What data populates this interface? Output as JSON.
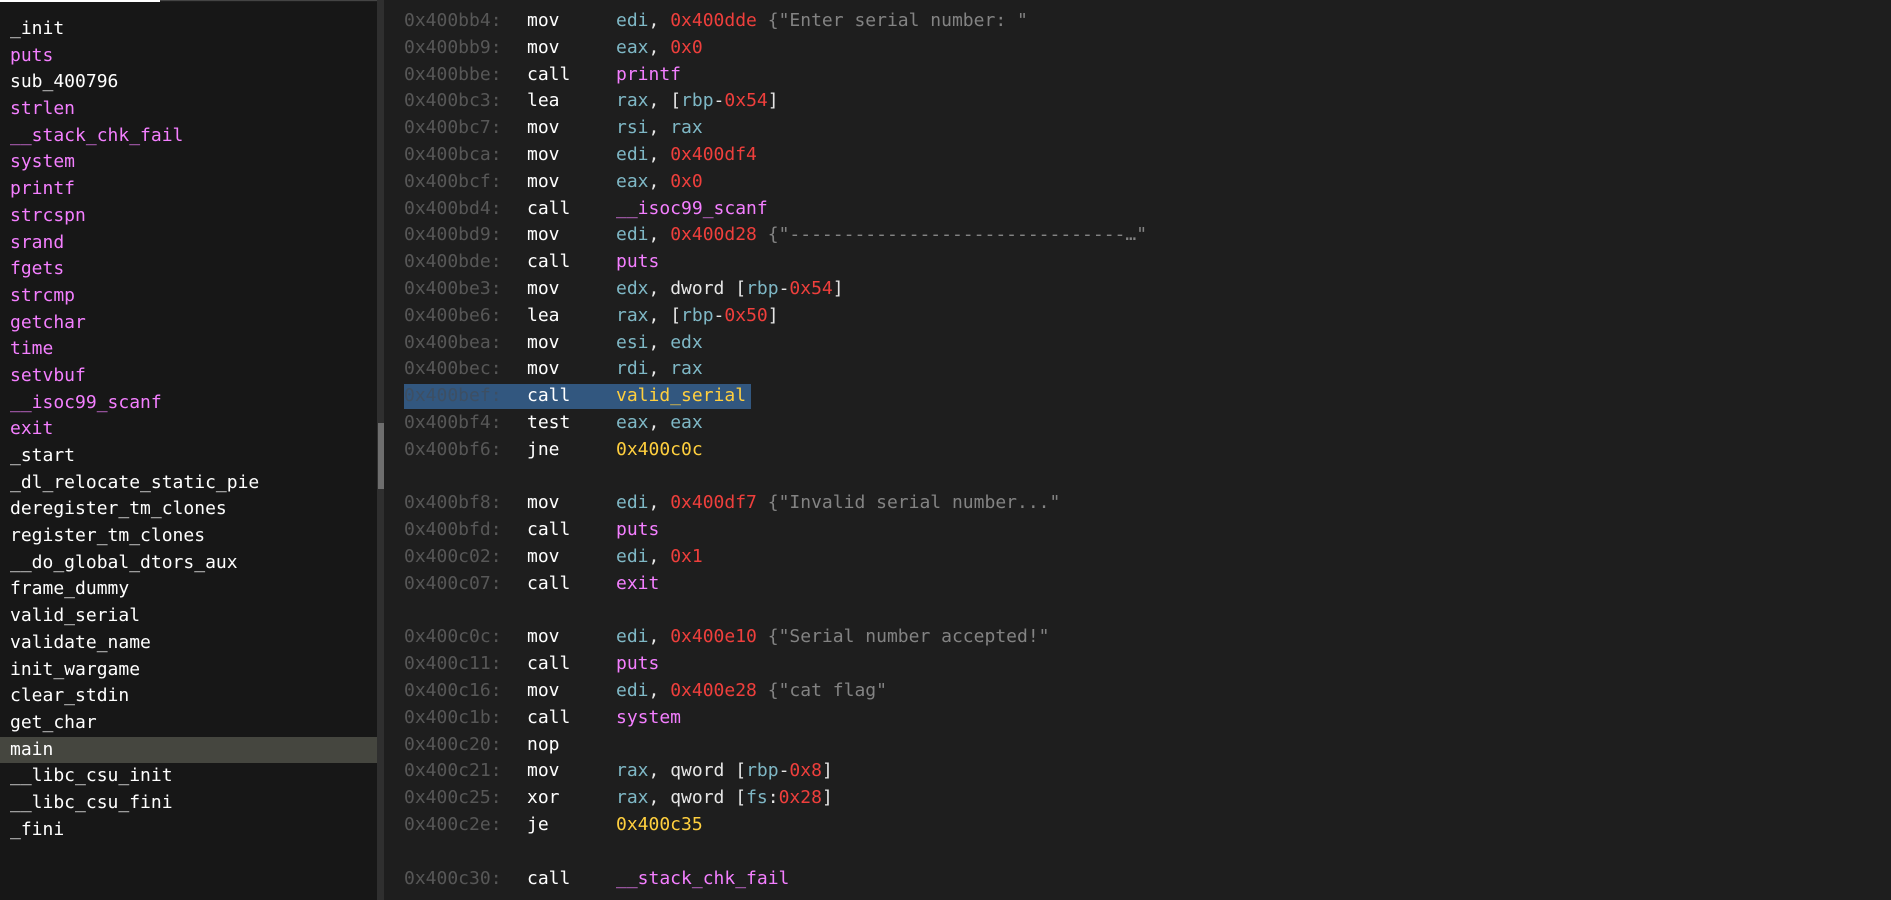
{
  "colors": {
    "register": "#7fb8c6",
    "number": "#ef3f3c",
    "comment": "#838383",
    "import_symbol": "#f47fff",
    "local_symbol": "#ffcf3e",
    "address": "#575757",
    "selection": "#32577f"
  },
  "functions": [
    {
      "name": "_init",
      "kind": "local"
    },
    {
      "name": "puts",
      "kind": "import"
    },
    {
      "name": "sub_400796",
      "kind": "local"
    },
    {
      "name": "strlen",
      "kind": "import"
    },
    {
      "name": "__stack_chk_fail",
      "kind": "import"
    },
    {
      "name": "system",
      "kind": "import"
    },
    {
      "name": "printf",
      "kind": "import"
    },
    {
      "name": "strcspn",
      "kind": "import"
    },
    {
      "name": "srand",
      "kind": "import"
    },
    {
      "name": "fgets",
      "kind": "import"
    },
    {
      "name": "strcmp",
      "kind": "import"
    },
    {
      "name": "getchar",
      "kind": "import"
    },
    {
      "name": "time",
      "kind": "import"
    },
    {
      "name": "setvbuf",
      "kind": "import"
    },
    {
      "name": "__isoc99_scanf",
      "kind": "import"
    },
    {
      "name": "exit",
      "kind": "import"
    },
    {
      "name": "_start",
      "kind": "local"
    },
    {
      "name": "_dl_relocate_static_pie",
      "kind": "local"
    },
    {
      "name": "deregister_tm_clones",
      "kind": "local"
    },
    {
      "name": "register_tm_clones",
      "kind": "local"
    },
    {
      "name": "__do_global_dtors_aux",
      "kind": "local"
    },
    {
      "name": "frame_dummy",
      "kind": "local"
    },
    {
      "name": "valid_serial",
      "kind": "local"
    },
    {
      "name": "validate_name",
      "kind": "local"
    },
    {
      "name": "init_wargame",
      "kind": "local"
    },
    {
      "name": "clear_stdin",
      "kind": "local"
    },
    {
      "name": "get_char",
      "kind": "local"
    },
    {
      "name": "main",
      "kind": "local",
      "selected": true
    },
    {
      "name": "__libc_csu_init",
      "kind": "local"
    },
    {
      "name": "__libc_csu_fini",
      "kind": "local"
    },
    {
      "name": "_fini",
      "kind": "local"
    }
  ],
  "disassembly": [
    {
      "addr": "0x400bb4:",
      "mnemonic": "mov",
      "ops": [
        [
          "reg",
          "edi"
        ],
        [
          "txt",
          ", "
        ],
        [
          "num",
          "0x400dde"
        ],
        [
          "cmt",
          " {\"Enter serial number: \""
        ]
      ]
    },
    {
      "addr": "0x400bb9:",
      "mnemonic": "mov",
      "ops": [
        [
          "reg",
          "eax"
        ],
        [
          "txt",
          ", "
        ],
        [
          "num",
          "0x0"
        ]
      ]
    },
    {
      "addr": "0x400bbe:",
      "mnemonic": "call",
      "ops": [
        [
          "imp",
          "printf"
        ]
      ]
    },
    {
      "addr": "0x400bc3:",
      "mnemonic": "lea",
      "ops": [
        [
          "reg",
          "rax"
        ],
        [
          "txt",
          ", ["
        ],
        [
          "reg",
          "rbp"
        ],
        [
          "txt",
          "-"
        ],
        [
          "num",
          "0x54"
        ],
        [
          "txt",
          "]"
        ]
      ]
    },
    {
      "addr": "0x400bc7:",
      "mnemonic": "mov",
      "ops": [
        [
          "reg",
          "rsi"
        ],
        [
          "txt",
          ", "
        ],
        [
          "reg",
          "rax"
        ]
      ]
    },
    {
      "addr": "0x400bca:",
      "mnemonic": "mov",
      "ops": [
        [
          "reg",
          "edi"
        ],
        [
          "txt",
          ", "
        ],
        [
          "num",
          "0x400df4"
        ]
      ]
    },
    {
      "addr": "0x400bcf:",
      "mnemonic": "mov",
      "ops": [
        [
          "reg",
          "eax"
        ],
        [
          "txt",
          ", "
        ],
        [
          "num",
          "0x0"
        ]
      ]
    },
    {
      "addr": "0x400bd4:",
      "mnemonic": "call",
      "ops": [
        [
          "imp",
          "__isoc99_scanf"
        ]
      ]
    },
    {
      "addr": "0x400bd9:",
      "mnemonic": "mov",
      "ops": [
        [
          "reg",
          "edi"
        ],
        [
          "txt",
          ", "
        ],
        [
          "num",
          "0x400d28"
        ],
        [
          "cmt",
          " {\"-------------------------------…\""
        ]
      ]
    },
    {
      "addr": "0x400bde:",
      "mnemonic": "call",
      "ops": [
        [
          "imp",
          "puts"
        ]
      ]
    },
    {
      "addr": "0x400be3:",
      "mnemonic": "mov",
      "ops": [
        [
          "reg",
          "edx"
        ],
        [
          "txt",
          ", dword ["
        ],
        [
          "reg",
          "rbp"
        ],
        [
          "txt",
          "-"
        ],
        [
          "num",
          "0x54"
        ],
        [
          "txt",
          "]"
        ]
      ]
    },
    {
      "addr": "0x400be6:",
      "mnemonic": "lea",
      "ops": [
        [
          "reg",
          "rax"
        ],
        [
          "txt",
          ", ["
        ],
        [
          "reg",
          "rbp"
        ],
        [
          "txt",
          "-"
        ],
        [
          "num",
          "0x50"
        ],
        [
          "txt",
          "]"
        ]
      ]
    },
    {
      "addr": "0x400bea:",
      "mnemonic": "mov",
      "ops": [
        [
          "reg",
          "esi"
        ],
        [
          "txt",
          ", "
        ],
        [
          "reg",
          "edx"
        ]
      ]
    },
    {
      "addr": "0x400bec:",
      "mnemonic": "mov",
      "ops": [
        [
          "reg",
          "rdi"
        ],
        [
          "txt",
          ", "
        ],
        [
          "reg",
          "rax"
        ]
      ]
    },
    {
      "addr": "0x400bef:",
      "mnemonic": "call",
      "ops": [
        [
          "loc",
          "valid_serial"
        ]
      ],
      "highlight": true
    },
    {
      "addr": "0x400bf4:",
      "mnemonic": "test",
      "ops": [
        [
          "reg",
          "eax"
        ],
        [
          "txt",
          ", "
        ],
        [
          "reg",
          "eax"
        ]
      ]
    },
    {
      "addr": "0x400bf6:",
      "mnemonic": "jne",
      "ops": [
        [
          "loc",
          "0x400c0c"
        ]
      ]
    },
    {
      "blank": true
    },
    {
      "addr": "0x400bf8:",
      "mnemonic": "mov",
      "ops": [
        [
          "reg",
          "edi"
        ],
        [
          "txt",
          ", "
        ],
        [
          "num",
          "0x400df7"
        ],
        [
          "cmt",
          " {\"Invalid serial number...\""
        ]
      ]
    },
    {
      "addr": "0x400bfd:",
      "mnemonic": "call",
      "ops": [
        [
          "imp",
          "puts"
        ]
      ]
    },
    {
      "addr": "0x400c02:",
      "mnemonic": "mov",
      "ops": [
        [
          "reg",
          "edi"
        ],
        [
          "txt",
          ", "
        ],
        [
          "num",
          "0x1"
        ]
      ]
    },
    {
      "addr": "0x400c07:",
      "mnemonic": "call",
      "ops": [
        [
          "imp",
          "exit"
        ]
      ]
    },
    {
      "blank": true
    },
    {
      "addr": "0x400c0c:",
      "mnemonic": "mov",
      "ops": [
        [
          "reg",
          "edi"
        ],
        [
          "txt",
          ", "
        ],
        [
          "num",
          "0x400e10"
        ],
        [
          "cmt",
          " {\"Serial number accepted!\""
        ]
      ]
    },
    {
      "addr": "0x400c11:",
      "mnemonic": "call",
      "ops": [
        [
          "imp",
          "puts"
        ]
      ]
    },
    {
      "addr": "0x400c16:",
      "mnemonic": "mov",
      "ops": [
        [
          "reg",
          "edi"
        ],
        [
          "txt",
          ", "
        ],
        [
          "num",
          "0x400e28"
        ],
        [
          "cmt",
          " {\"cat flag\""
        ]
      ]
    },
    {
      "addr": "0x400c1b:",
      "mnemonic": "call",
      "ops": [
        [
          "imp",
          "system"
        ]
      ]
    },
    {
      "addr": "0x400c20:",
      "mnemonic": "nop",
      "ops": []
    },
    {
      "addr": "0x400c21:",
      "mnemonic": "mov",
      "ops": [
        [
          "reg",
          "rax"
        ],
        [
          "txt",
          ", qword ["
        ],
        [
          "reg",
          "rbp"
        ],
        [
          "txt",
          "-"
        ],
        [
          "num",
          "0x8"
        ],
        [
          "txt",
          "]"
        ]
      ]
    },
    {
      "addr": "0x400c25:",
      "mnemonic": "xor",
      "ops": [
        [
          "reg",
          "rax"
        ],
        [
          "txt",
          ", qword ["
        ],
        [
          "reg",
          "fs"
        ],
        [
          "txt",
          ":"
        ],
        [
          "num",
          "0x28"
        ],
        [
          "txt",
          "]"
        ]
      ]
    },
    {
      "addr": "0x400c2e:",
      "mnemonic": "je",
      "ops": [
        [
          "loc",
          "0x400c35"
        ]
      ]
    },
    {
      "blank": true
    },
    {
      "addr": "0x400c30:",
      "mnemonic": "call",
      "ops": [
        [
          "imp",
          "__stack_chk_fail"
        ]
      ]
    }
  ]
}
